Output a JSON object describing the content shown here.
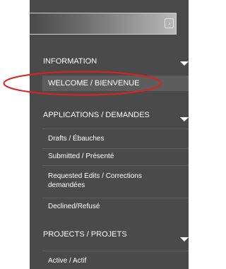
{
  "search": {
    "value": "",
    "chevron_glyph": "›"
  },
  "sections": [
    {
      "label": "INFORMATION",
      "items": [
        "WELCOME / BIENVENUE"
      ]
    },
    {
      "label": "APPLICATIONS / DEMANDES",
      "items": [
        "Drafts / Ébauches",
        "Submitted / Présenté",
        "Requested Edits / Corrections demandées",
        "Declined/Refusé"
      ]
    },
    {
      "label": "PROJECTS / PROJETS",
      "items": [
        "Active / Actif"
      ]
    }
  ],
  "colors": {
    "sidebar_bg": "#4a4a4a",
    "active_item_bg": "#5d5d5d",
    "highlight_oval": "#e0201f"
  }
}
